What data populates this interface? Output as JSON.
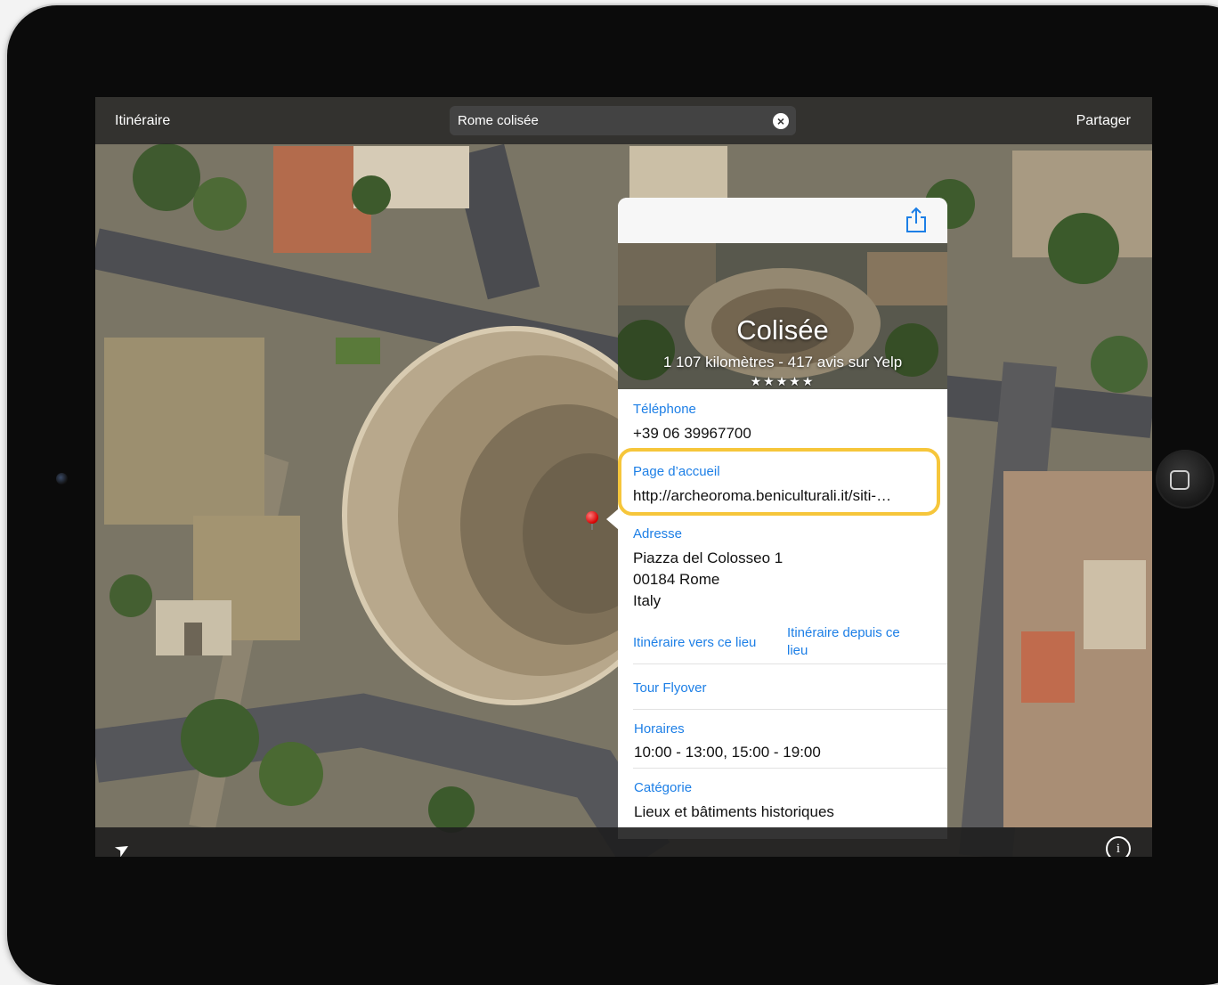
{
  "topbar": {
    "route_label": "Itinéraire",
    "search_value": "Rome colisée",
    "share_label": "Partager"
  },
  "card": {
    "title": "Colisée",
    "meta": "1 107 kilomètres - 417 avis sur Yelp",
    "stars": "★★★★★",
    "phone_label": "Téléphone",
    "phone_value": "+39 06 39967700",
    "homepage_label": "Page d’accueil",
    "homepage_value": "http://archeoroma.beniculturali.it/siti-…",
    "address_label": "Adresse",
    "address_line1": "Piazza del Colosseo 1",
    "address_line2": "00184 Rome",
    "address_line3": "Italy",
    "route_to": "Itinéraire vers ce lieu",
    "route_from_line1": "Itinéraire depuis ce",
    "route_from_line2": "lieu",
    "flyover": "Tour Flyover",
    "hours_label": "Horaires",
    "hours_value": "10:00 - 13:00, 15:00 - 19:00",
    "category_label": "Catégorie",
    "category_value": "Lieux et bâtiments historiques"
  },
  "icons": {
    "clear": "clear-icon",
    "share": "share-icon",
    "locate": "location-arrow-icon",
    "info": "info-icon"
  },
  "colors": {
    "accent": "#1d7fe6",
    "highlight": "#f6c63b",
    "pin": "#d40000"
  }
}
